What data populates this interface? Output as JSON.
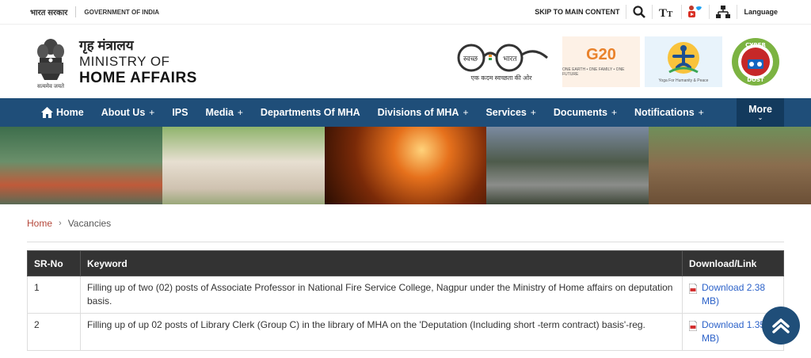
{
  "topbar": {
    "gov_hindi": "भारत सरकार",
    "gov_english": "GOVERNMENT OF INDIA",
    "skip_link": "SKIP TO MAIN CONTENT",
    "language": "Language"
  },
  "header": {
    "title_hindi": "गृह मंत्रालय",
    "title_en_line1": "MINISTRY OF",
    "title_en_line2": "HOME AFFAIRS",
    "emblem_motto": "सत्यमेव जयते",
    "swachh_left": "स्वच्छ",
    "swachh_right": "भारत",
    "swachh_tagline": "एक कदम स्वच्छता की ओर",
    "g20_text": "G20",
    "g20_sub": "ONE EARTH • ONE FAMILY • ONE FUTURE",
    "yoga_sub": "Yoga For Humanity & Peace",
    "cyber_top": "CYBER",
    "cyber_bottom": "DOST"
  },
  "nav": {
    "items": [
      {
        "label": "Home",
        "plus": false
      },
      {
        "label": "About Us",
        "plus": true
      },
      {
        "label": "IPS",
        "plus": false
      },
      {
        "label": "Media",
        "plus": true
      },
      {
        "label": "Departments Of MHA",
        "plus": false
      },
      {
        "label": "Divisions of MHA",
        "plus": true
      },
      {
        "label": "Services",
        "plus": true
      },
      {
        "label": "Documents",
        "plus": true
      },
      {
        "label": "Notifications",
        "plus": true
      }
    ],
    "more": "More"
  },
  "breadcrumb": {
    "home": "Home",
    "current": "Vacancies"
  },
  "table": {
    "headers": [
      "SR-No",
      "Keyword",
      "Download/Link"
    ],
    "rows": [
      {
        "sr": "1",
        "keyword": "Filling up of two (02) posts of Associate Professor in National Fire Service College, Nagpur under the Ministry of Home affairs on deputation basis.",
        "download": "Download 2.38 MB)"
      },
      {
        "sr": "2",
        "keyword": "Filling up of up 02 posts of Library Clerk (Group C) in the library of MHA on the 'Deputation (Including short -term contract) basis'-reg.",
        "download": "Download 1.35 MB)"
      }
    ]
  },
  "colors": {
    "nav_bg": "#1f4e79",
    "more_bg": "#133a5d",
    "table_header_bg": "#333333",
    "link": "#2c62c9",
    "breadcrumb_home": "#b5473a"
  }
}
